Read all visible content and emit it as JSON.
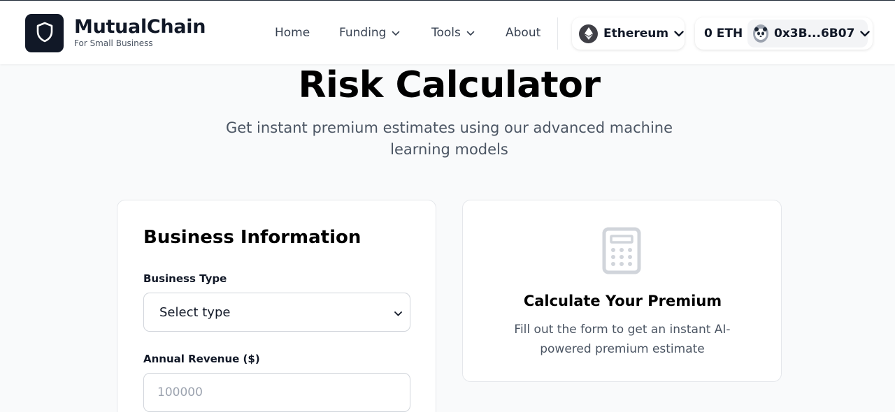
{
  "brand": {
    "name": "MutualChain",
    "tagline": "For Small Business"
  },
  "nav": {
    "items": [
      {
        "label": "Home",
        "has_dropdown": false
      },
      {
        "label": "Funding",
        "has_dropdown": true
      },
      {
        "label": "Tools",
        "has_dropdown": true
      },
      {
        "label": "About",
        "has_dropdown": false
      }
    ]
  },
  "wallet": {
    "network": "Ethereum",
    "balance": "0 ETH",
    "address": "0x3B...6B07"
  },
  "hero": {
    "title": "Risk Calculator",
    "subtitle": "Get instant premium estimates using our advanced machine learning models"
  },
  "form": {
    "title": "Business Information",
    "business_type_label": "Business Type",
    "business_type_value": "Select type",
    "annual_revenue_label": "Annual Revenue ($)",
    "annual_revenue_placeholder": "100000"
  },
  "result": {
    "title": "Calculate Your Premium",
    "description": "Fill out the form to get an instant AI-powered premium estimate"
  },
  "colors": {
    "page_bg": "#f9fafb",
    "logo_bg": "#111827",
    "text_primary": "#111827",
    "text_muted": "#4b5563",
    "icon_gray": "#d1d5db"
  }
}
